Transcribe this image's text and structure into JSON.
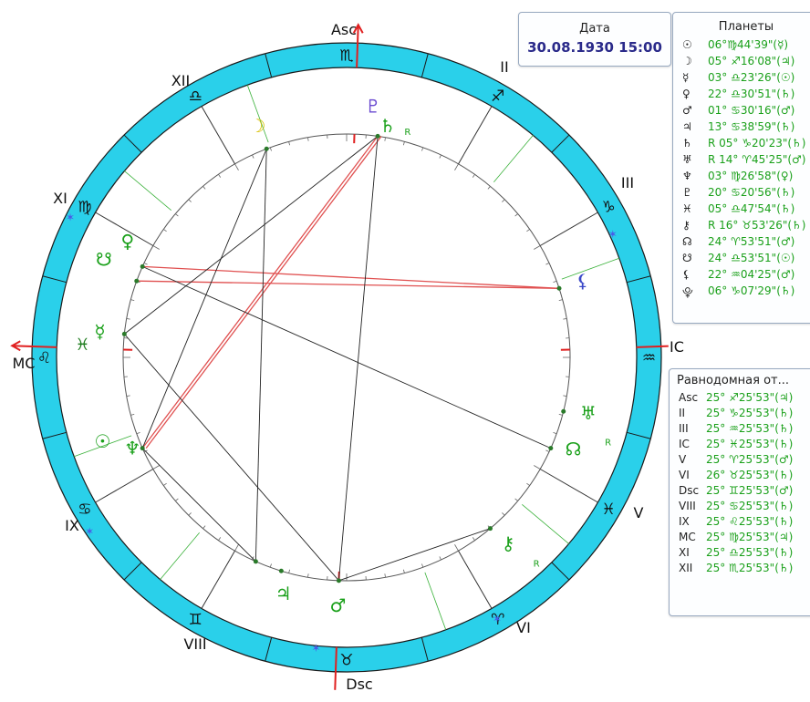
{
  "axis_labels": {
    "asc": "Asc",
    "mc": "MC",
    "ic": "IC",
    "dsc": "Dsc"
  },
  "house_numerals": [
    "II",
    "III",
    "V",
    "VI",
    "VIII",
    "IX",
    "XI",
    "XII"
  ],
  "date_panel": {
    "title": "Дата",
    "value": "30.08.1930  15:00"
  },
  "planets_panel": {
    "title": "Планеты",
    "rows": [
      {
        "symbol": "☉",
        "text": "06°♍44'39\"(☿)"
      },
      {
        "symbol": "☽",
        "text": "05° ♐16'08\"(♃)"
      },
      {
        "symbol": "☿",
        "text": "03° ♎23'26\"(☉)"
      },
      {
        "symbol": "♀",
        "text": "22° ♎30'51\"(♄)"
      },
      {
        "symbol": "♂",
        "text": "01° ♋30'16\"(♂)"
      },
      {
        "symbol": "♃",
        "text": "13° ♋38'59\"(♄)"
      },
      {
        "symbol": "♄",
        "text": "R 05° ♑20'23\"(♄)"
      },
      {
        "symbol": "♅",
        "text": "R 14° ♈45'25\"(♂)"
      },
      {
        "symbol": "♆",
        "text": "03° ♍26'58\"(♀)"
      },
      {
        "symbol": "♇",
        "text": "20° ♋20'56\"(♄)"
      },
      {
        "symbol": "♓",
        "text": "05° ♎47'54\"(♄)"
      },
      {
        "symbol": "⚷",
        "text": "R 16° ♉53'26\"(♄)"
      },
      {
        "symbol": "☊",
        "text": "24° ♈53'51\"(♂)"
      },
      {
        "symbol": "☋",
        "text": "24° ♎53'51\"(☉)"
      },
      {
        "symbol": "⚸",
        "text": "22° ♒04'25\"(♂)"
      },
      {
        "symbol": "⯓",
        "text": "06° ♑07'29\"(♄)"
      }
    ]
  },
  "houses_panel": {
    "title": "Равнодомная от...",
    "rows": [
      {
        "name": "Asc",
        "text": "25° ♐25'53\"(♃)"
      },
      {
        "name": "II",
        "text": "25° ♑25'53\"(♄)"
      },
      {
        "name": "III",
        "text": "25° ♒25'53\"(♄)"
      },
      {
        "name": "IC",
        "text": "25° ♓25'53\"(♄)"
      },
      {
        "name": "V",
        "text": "25° ♈25'53\"(♂)"
      },
      {
        "name": "VI",
        "text": "26° ♉25'53\"(♄)"
      },
      {
        "name": "Dsc",
        "text": "25° ♊25'53\"(♂)"
      },
      {
        "name": "VIII",
        "text": "25° ♋25'53\"(♄)"
      },
      {
        "name": "IX",
        "text": "25° ♌25'53\"(♄)"
      },
      {
        "name": "MC",
        "text": "25° ♍25'53\"(♃)"
      },
      {
        "name": "XI",
        "text": "25° ♎25'53\"(♄)"
      },
      {
        "name": "XII",
        "text": "25° ♏25'53\"(♄)"
      }
    ]
  },
  "zodiac_ring_signs": [
    "♐",
    "♑",
    "♒",
    "♓",
    "♈",
    "♉",
    "♊",
    "♋",
    "♌",
    "♍",
    "♎",
    "♏"
  ],
  "chart_planet_glyphs": {
    "pluto": "♇",
    "saturn": "♄",
    "saturn_r": "R",
    "moon": "☽",
    "lilith": "⚸",
    "node_south": "☋",
    "venus": "♀",
    "vesta": "⚶",
    "mercury": "☿",
    "sun": "☉",
    "neptune": "♆",
    "jupiter": "♃",
    "mars": "♂",
    "uranus": "♅",
    "uranus_r": "R",
    "node_north": "☊",
    "chiron": "⚷",
    "chiron_r": "R"
  },
  "colors": {
    "ring": "#2ad0ea",
    "ring_border": "#1a1a1a",
    "axis": "#e02020",
    "house_cusp": "#333333",
    "planet_glyph": "#1aa01a",
    "aspect_red": "#e05050",
    "aspect_black": "#222222",
    "star_blue": "#4a5ae8",
    "moon_yellow": "#d8c000"
  }
}
